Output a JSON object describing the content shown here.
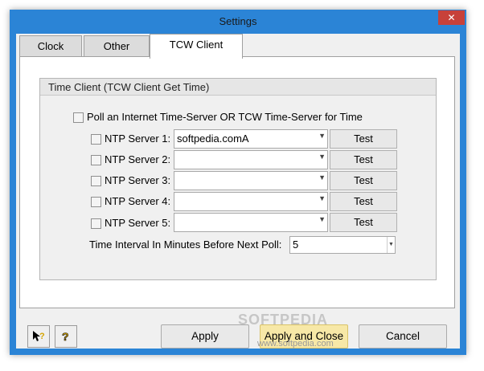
{
  "window": {
    "title": "Settings",
    "close_glyph": "✕"
  },
  "tabs": [
    {
      "label": "Clock",
      "active": false
    },
    {
      "label": "Other",
      "active": false
    },
    {
      "label": "TCW Client",
      "active": true
    }
  ],
  "group": {
    "title": "Time Client (TCW Client Get Time)",
    "poll_label": "Poll an Internet Time-Server OR TCW Time-Server for Time",
    "poll_checked": false,
    "servers": [
      {
        "label": "NTP Server 1:",
        "value": "softpedia.comA",
        "checked": false,
        "test_label": "Test"
      },
      {
        "label": "NTP Server 2:",
        "value": "",
        "checked": false,
        "test_label": "Test"
      },
      {
        "label": "NTP Server 3:",
        "value": "",
        "checked": false,
        "test_label": "Test"
      },
      {
        "label": "NTP Server 4:",
        "value": "",
        "checked": false,
        "test_label": "Test"
      },
      {
        "label": "NTP Server 5:",
        "value": "",
        "checked": false,
        "test_label": "Test"
      }
    ],
    "interval_label": "Time Interval In Minutes Before Next Poll:",
    "interval_value": "5"
  },
  "footer": {
    "apply_label": "Apply",
    "apply_close_label": "Apply and Close",
    "cancel_label": "Cancel",
    "help_pointer_icon": "whats-this-help-icon",
    "help_icon": "help-icon"
  },
  "watermark": {
    "text": "www.softpedia.com",
    "overlay": "SOFTPEDIA"
  },
  "colors": {
    "title_bar": "#2b84d6",
    "close_button": "#c7413a",
    "primary_button": "#f7e8a7"
  }
}
